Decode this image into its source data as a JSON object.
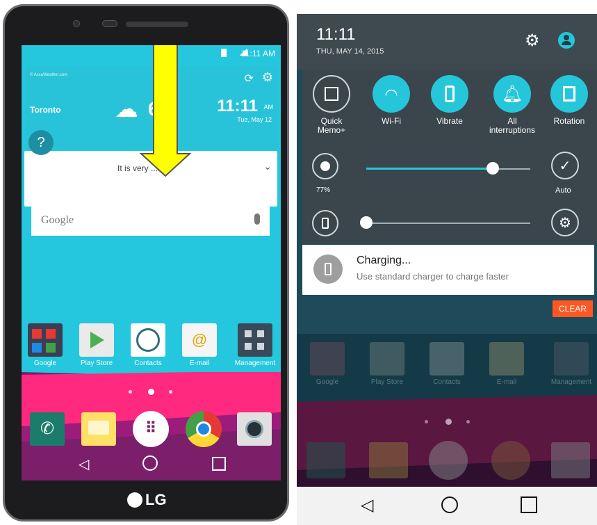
{
  "left_phone": {
    "status_time": "11:11 AM",
    "weather_source": "© AccuWeather.com",
    "city": "Toronto",
    "temp_partial": "6°c",
    "clock_time": "11:11",
    "clock_ampm": "AM",
    "clock_date": "Tue, May 12",
    "weather_message": "It is very ....",
    "search_placeholder": "Google",
    "brand": "LG",
    "apps": [
      {
        "label": "Google",
        "icon": "google-folder-icon"
      },
      {
        "label": "Play Store",
        "icon": "play-store-icon"
      },
      {
        "label": "Contacts",
        "icon": "contacts-icon"
      },
      {
        "label": "E-mail",
        "icon": "email-icon"
      },
      {
        "label": "Management",
        "icon": "management-folder-icon"
      }
    ],
    "dock": [
      "phone-icon",
      "messaging-icon",
      "apps-drawer-icon",
      "chrome-icon",
      "camera-icon"
    ],
    "arrow_color": "#ffff00"
  },
  "right_panel": {
    "time": "11:11",
    "date": "THU, MAY 14, 2015",
    "quick_settings": [
      {
        "label": "Quick Memo+",
        "active": false
      },
      {
        "label": "Wi-Fi",
        "active": true
      },
      {
        "label": "Vibrate",
        "active": true
      },
      {
        "label": "All interruptions",
        "active": true
      },
      {
        "label": "Rotation",
        "active": true
      }
    ],
    "brightness_percent": "77%",
    "brightness_level": 0.77,
    "auto_label": "Auto",
    "volume_level": 0.0,
    "notification_title": "Charging...",
    "notification_text": "Use standard charger to charge faster",
    "clear_label": "CLEAR",
    "apps": [
      {
        "label": "Google"
      },
      {
        "label": "Play Store"
      },
      {
        "label": "Contacts"
      },
      {
        "label": "E-mail"
      },
      {
        "label": "Management"
      }
    ],
    "accent_color": "#26c6da",
    "clear_color": "#ff5722"
  }
}
